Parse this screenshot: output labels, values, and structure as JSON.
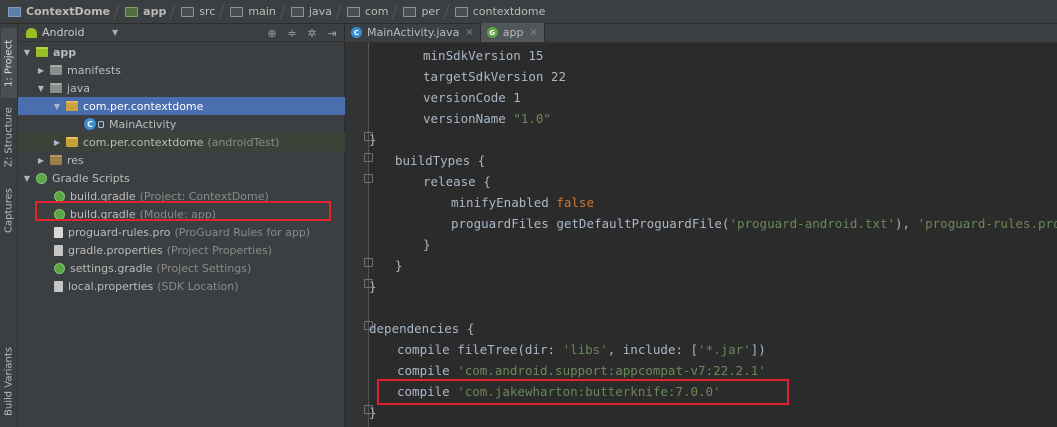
{
  "breadcrumb": [
    "ContextDome",
    "app",
    "src",
    "main",
    "java",
    "com",
    "per",
    "contextdome"
  ],
  "toolstrip": {
    "tabs": [
      "1: Project",
      "Z: Structure",
      "Captures",
      "Build Variants"
    ]
  },
  "project_panel": {
    "view": "Android",
    "tree": [
      {
        "label": "app",
        "muted": ""
      },
      {
        "label": "manifests",
        "muted": ""
      },
      {
        "label": "java",
        "muted": ""
      },
      {
        "label": "com.per.contextdome",
        "muted": ""
      },
      {
        "label": "MainActivity",
        "muted": ""
      },
      {
        "label": "com.per.contextdome",
        "muted": "(androidTest)"
      },
      {
        "label": "res",
        "muted": ""
      },
      {
        "label": "Gradle Scripts",
        "muted": ""
      },
      {
        "label": "build.gradle",
        "muted": "(Project: ContextDome)"
      },
      {
        "label": "build.gradle",
        "muted": "(Module: app)"
      },
      {
        "label": "proguard-rules.pro",
        "muted": "(ProGuard Rules for app)"
      },
      {
        "label": "gradle.properties",
        "muted": "(Project Properties)"
      },
      {
        "label": "settings.gradle",
        "muted": "(Project Settings)"
      },
      {
        "label": "local.properties",
        "muted": "(SDK Location)"
      }
    ]
  },
  "editor_tabs": [
    {
      "label": "MainActivity.java",
      "icon": "C"
    },
    {
      "label": "app",
      "icon": "G"
    }
  ],
  "code_lines": [
    {
      "tokens": [
        {
          "t": "minSdkVersion 15",
          "c": ""
        }
      ]
    },
    {
      "tokens": [
        {
          "t": "targetSdkVersion 22",
          "c": ""
        }
      ]
    },
    {
      "tokens": [
        {
          "t": "versionCode 1",
          "c": ""
        }
      ]
    },
    {
      "tokens": [
        {
          "t": "versionName ",
          "c": ""
        },
        {
          "t": "\"1.0\"",
          "c": "str"
        }
      ]
    },
    {
      "tokens": [
        {
          "t": "}",
          "c": ""
        }
      ]
    },
    {
      "tokens": [
        {
          "t": "buildTypes {",
          "c": ""
        }
      ]
    },
    {
      "tokens": [
        {
          "t": "release {",
          "c": ""
        }
      ]
    },
    {
      "tokens": [
        {
          "t": "minifyEnabled ",
          "c": ""
        },
        {
          "t": "false",
          "c": "kw"
        }
      ]
    },
    {
      "tokens": [
        {
          "t": "proguardFiles getDefaultProguardFile(",
          "c": ""
        },
        {
          "t": "'proguard-android.txt'",
          "c": "str"
        },
        {
          "t": "), ",
          "c": ""
        },
        {
          "t": "'proguard-rules.pro'",
          "c": "str"
        }
      ]
    },
    {
      "tokens": [
        {
          "t": "}",
          "c": ""
        }
      ]
    },
    {
      "tokens": [
        {
          "t": "}",
          "c": ""
        }
      ]
    },
    {
      "tokens": [
        {
          "t": "}",
          "c": ""
        }
      ]
    },
    {
      "tokens": []
    },
    {
      "tokens": [
        {
          "t": "dependencies {",
          "c": ""
        }
      ]
    },
    {
      "tokens": [
        {
          "t": "compile fileTree(dir: ",
          "c": ""
        },
        {
          "t": "'libs'",
          "c": "str"
        },
        {
          "t": ", include: [",
          "c": ""
        },
        {
          "t": "'*.jar'",
          "c": "str"
        },
        {
          "t": "])",
          "c": ""
        }
      ]
    },
    {
      "tokens": [
        {
          "t": "compile ",
          "c": ""
        },
        {
          "t": "'com.android.support:appcompat-v7:22.2.1'",
          "c": "str"
        }
      ]
    },
    {
      "tokens": [
        {
          "t": "compile ",
          "c": ""
        },
        {
          "t": "'com.jakewharton:butterknife:7.0.0'",
          "c": "str"
        }
      ]
    },
    {
      "tokens": [
        {
          "t": "}",
          "c": ""
        }
      ]
    }
  ]
}
